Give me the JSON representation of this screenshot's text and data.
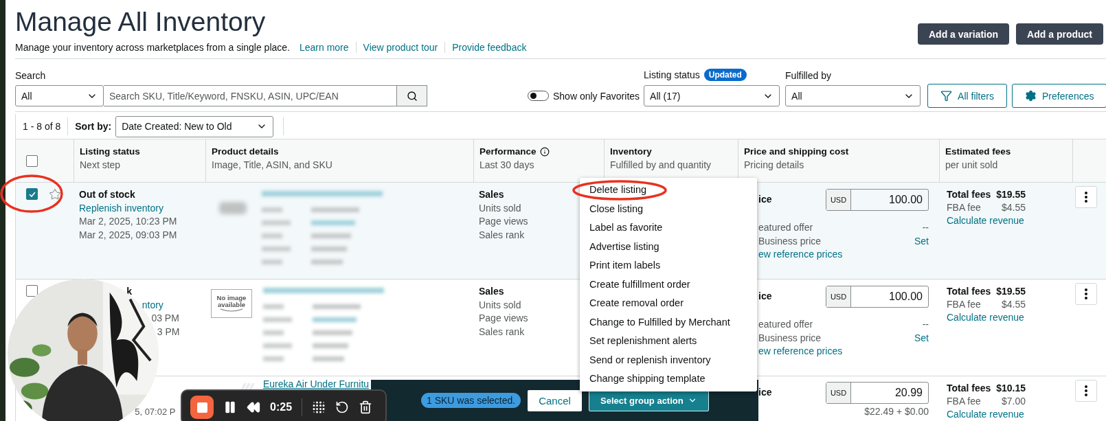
{
  "page": {
    "title": "Manage All Inventory",
    "subtitle": "Manage your inventory across marketplaces from a single place.",
    "links": [
      "Learn more",
      "View product tour",
      "Provide feedback"
    ]
  },
  "header_buttons": [
    "Add a variation",
    "Add a product"
  ],
  "search": {
    "label": "Search",
    "scope": "All",
    "placeholder": "Search SKU, Title/Keyword, FNSKU, ASIN, UPC/EAN"
  },
  "favorites_toggle": {
    "label": "Show only Favorites",
    "on": false
  },
  "listing_status_filter": {
    "label": "Listing status",
    "badge": "Updated",
    "value": "All (17)"
  },
  "fulfilled_by_filter": {
    "label": "Fulfilled by",
    "value": "All"
  },
  "filter_buttons": [
    {
      "kind": "filter",
      "label": "All filters"
    },
    {
      "kind": "settings",
      "label": "Preferences"
    }
  ],
  "results": {
    "count": "1 - 8 of 8",
    "sort_label": "Sort by:",
    "sort_value": "Date Created: New to Old"
  },
  "table": {
    "select_all_checked": false,
    "columns": [
      {
        "title": "Listing status",
        "subtitle": "Next step",
        "info": false
      },
      {
        "title": "Product details",
        "subtitle": "Image, Title, ASIN, and SKU",
        "info": false
      },
      {
        "title": "Performance",
        "subtitle": "Last 30 days",
        "info": true
      },
      {
        "title": "Inventory",
        "subtitle": "Fulfilled by and quantity",
        "info": false
      },
      {
        "title": "Price and shipping cost",
        "subtitle": "Pricing details",
        "info": false
      },
      {
        "title": "Estimated fees",
        "subtitle": "per unit sold",
        "info": false
      }
    ],
    "rows": [
      {
        "checked": true,
        "favorite": false,
        "annotated": true,
        "status": [
          {
            "kind": "status",
            "text": "Out of stock"
          },
          {
            "kind": "link",
            "text": "Replenish inventory"
          },
          {
            "kind": "date",
            "text": "Mar 2, 2025, 10:23 PM"
          },
          {
            "kind": "date",
            "text": "Mar 2, 2025, 09:03 PM"
          }
        ],
        "product": {
          "kind": "blurred"
        },
        "performance": [
          "Sales",
          "Units sold",
          "Page views",
          "Sales rank"
        ],
        "price": {
          "label": "ice",
          "currency": "USD",
          "amount": "100.00",
          "lines": [
            {
              "left": "eatured offer",
              "right": "--",
              "right_link": false
            },
            {
              "left": "Business price",
              "right": "Set",
              "right_link": true
            }
          ],
          "link": "ew reference prices"
        },
        "fees": {
          "total_label": "Total fees",
          "total": "$19.55",
          "fee_label": "FBA fee",
          "fee": "$4.55",
          "link": "Calculate revenue"
        }
      },
      {
        "checked": false,
        "annotated": false,
        "status": [
          {
            "kind": "status",
            "text": "k"
          },
          {
            "kind": "link",
            "text": "ntory"
          },
          {
            "kind": "date",
            "text": "03 PM"
          },
          {
            "kind": "date",
            "text": "3 PM"
          }
        ],
        "product": {
          "kind": "placeholder",
          "placeholder": "No image available"
        },
        "performance": [
          "Sales",
          "Units sold",
          "Page views",
          "Sales rank"
        ],
        "price": {
          "label": "ice",
          "currency": "USD",
          "amount": "100.00",
          "lines": [
            {
              "left": "eatured offer",
              "right": "--",
              "right_link": false
            },
            {
              "left": "Business price",
              "right": "Set",
              "right_link": true
            }
          ],
          "link": "ew reference prices"
        },
        "fees": {
          "total_label": "Total fees",
          "total": "$19.55",
          "fee_label": "FBA fee",
          "fee": "$4.55",
          "link": "Calculate revenue"
        }
      },
      {
        "status": [
          {
            "kind": "date",
            "text": "5, 07:02 P"
          }
        ],
        "product": {
          "kind": "titled",
          "title": "Eureka Air Under Furnitu"
        },
        "price": {
          "label": "ice",
          "currency": "USD",
          "amount": "20.99",
          "lines": [
            {
              "right": "$22.49 + $0.00",
              "right_link": false
            }
          ]
        },
        "fees": {
          "total_label": "Total fees",
          "total": "$10.15",
          "fee_label": "FBA fee",
          "fee": "$7.00",
          "link": "Calculate revenue"
        }
      }
    ]
  },
  "action_menu": {
    "items": [
      {
        "label": "Delete listing",
        "annotated": true
      },
      {
        "label": "Close listing",
        "annotated": false
      },
      {
        "label": "Label as favorite",
        "annotated": false
      },
      {
        "label": "Advertise listing",
        "annotated": false
      },
      {
        "label": "Print item labels",
        "annotated": false
      },
      {
        "label": "Create fulfillment order",
        "annotated": false
      },
      {
        "label": "Create removal order",
        "annotated": false
      },
      {
        "label": "Change to Fulfilled by Merchant",
        "annotated": false
      },
      {
        "label": "Set replenishment alerts",
        "annotated": false
      },
      {
        "label": "Send or replenish inventory",
        "annotated": false
      },
      {
        "label": "Change shipping template",
        "annotated": false
      }
    ]
  },
  "selection_bar": {
    "message": "1 SKU was selected.",
    "cancel": "Cancel",
    "action": "Select group action"
  },
  "recorder": {
    "time": "0:25"
  },
  "webcam": {
    "kind": "picture"
  }
}
